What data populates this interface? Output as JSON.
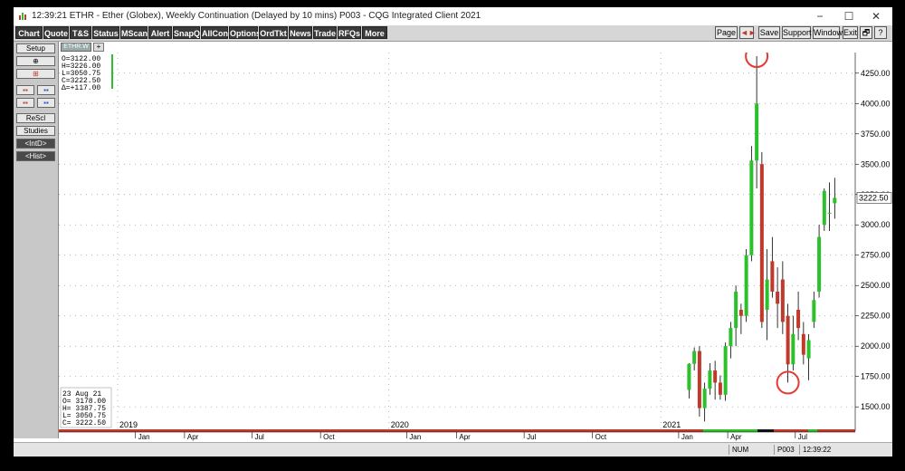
{
  "titlebar": {
    "time": "12:39:21",
    "title": "ETHR - Ether (Globex), Weekly Continuation (Delayed by 10 mins)   P003 - CQG Integrated Client 2021",
    "minimize": "−",
    "maximize": "☐",
    "close": "✕"
  },
  "toolbar": {
    "left": [
      "Chart",
      "Quote",
      "T&S",
      "Status",
      "MScan",
      "Alert",
      "SnapQ",
      "AllCon",
      "Options",
      "OrdTkt",
      "News",
      "Trade",
      "RFQs",
      "More"
    ],
    "page": "Page",
    "arrows": "◄►",
    "save": "Save",
    "support": "Support",
    "window": "Window",
    "exit": "Exit",
    "restore": "🗗",
    "help": "?"
  },
  "sidebar": {
    "setup": "Setup",
    "zoom": "⊕",
    "crosshair": "⊞",
    "b1": "▪▪",
    "b2": "▪▪",
    "b3": "▪▪",
    "b4": "▪▪",
    "rescl": "ReScl",
    "studies": "Studies",
    "intd": "<IntD>",
    "hist": "<Hist>"
  },
  "tab": {
    "name": "ETHR.W",
    "add": "+"
  },
  "status": {
    "num": "NUM",
    "page": "P003",
    "time": "12:39:22"
  },
  "chart_data": {
    "type": "ohlc",
    "symbol": "ETHR",
    "ylim": [
      1300,
      4420
    ],
    "yticks": [
      1500,
      1750,
      2000,
      2250,
      2500,
      2750,
      3000,
      3250,
      3500,
      3750,
      4000,
      4250
    ],
    "ytick_labels": [
      "1500.00",
      "1750.00",
      "2000.00",
      "2250.00",
      "2500.00",
      "2750.00",
      "3000.00",
      "3250.00",
      "3500.00",
      "3750.00",
      "4000.00",
      "4250.00"
    ],
    "last_price_label": "3222.50",
    "last_price": 3222.5,
    "xticks": [
      {
        "label": "2019",
        "year": true
      },
      {
        "label": "Jan"
      },
      {
        "label": "Apr"
      },
      {
        "label": "Jul"
      },
      {
        "label": "Oct"
      },
      {
        "label": "2020",
        "year": true
      },
      {
        "label": "Jan"
      },
      {
        "label": "Apr"
      },
      {
        "label": "Jul"
      },
      {
        "label": "Oct"
      },
      {
        "label": "2021",
        "year": true
      },
      {
        "label": "Jan"
      },
      {
        "label": "Apr"
      },
      {
        "label": "Jul"
      }
    ],
    "header_info": [
      "O=3122.00",
      "H=3226.00",
      "L=3050.75",
      "C=3222.50",
      "Δ=+117.00"
    ],
    "cursor_info": [
      "23 Aug 21",
      "O= 3178.00",
      "H= 3387.75",
      "L= 3050.75",
      "C= 3222.50"
    ],
    "bars": [
      {
        "date": "2021-02-08",
        "o": 1640,
        "h": 1860,
        "l": 1570,
        "c": 1855
      },
      {
        "date": "2021-02-15",
        "o": 1855,
        "h": 1990,
        "l": 1800,
        "c": 1960
      },
      {
        "date": "2021-02-22",
        "o": 1960,
        "h": 2000,
        "l": 1420,
        "c": 1490
      },
      {
        "date": "2021-03-01",
        "o": 1490,
        "h": 1700,
        "l": 1380,
        "c": 1650
      },
      {
        "date": "2021-03-08",
        "o": 1650,
        "h": 1860,
        "l": 1600,
        "c": 1800
      },
      {
        "date": "2021-03-15",
        "o": 1800,
        "h": 1880,
        "l": 1560,
        "c": 1700
      },
      {
        "date": "2021-03-22",
        "o": 1700,
        "h": 1760,
        "l": 1560,
        "c": 1600
      },
      {
        "date": "2021-03-29",
        "o": 1600,
        "h": 2030,
        "l": 1550,
        "c": 2000
      },
      {
        "date": "2021-04-05",
        "o": 2000,
        "h": 2200,
        "l": 1900,
        "c": 2150
      },
      {
        "date": "2021-04-12",
        "o": 2150,
        "h": 2500,
        "l": 2000,
        "c": 2450
      },
      {
        "date": "2021-04-19",
        "o": 2300,
        "h": 2350,
        "l": 2100,
        "c": 2250
      },
      {
        "date": "2021-04-26",
        "o": 2250,
        "h": 2800,
        "l": 2200,
        "c": 2750
      },
      {
        "date": "2021-05-03",
        "o": 2750,
        "h": 3650,
        "l": 2700,
        "c": 3530
      },
      {
        "date": "2021-05-10",
        "o": 3530,
        "h": 4390,
        "l": 3300,
        "c": 4000
      },
      {
        "date": "2021-05-17",
        "o": 3500,
        "h": 3600,
        "l": 2150,
        "c": 2200
      },
      {
        "date": "2021-05-24",
        "o": 2300,
        "h": 2800,
        "l": 2050,
        "c": 2550
      },
      {
        "date": "2021-05-31",
        "o": 2700,
        "h": 2900,
        "l": 2400,
        "c": 2450
      },
      {
        "date": "2021-06-07",
        "o": 2450,
        "h": 2650,
        "l": 2150,
        "c": 2350
      },
      {
        "date": "2021-06-14",
        "o": 2550,
        "h": 2700,
        "l": 2100,
        "c": 2200
      },
      {
        "date": "2021-06-21",
        "o": 2250,
        "h": 2350,
        "l": 1700,
        "c": 1850
      },
      {
        "date": "2021-06-28",
        "o": 1850,
        "h": 2250,
        "l": 1800,
        "c": 2100
      },
      {
        "date": "2021-07-05",
        "o": 2300,
        "h": 2450,
        "l": 2050,
        "c": 2150
      },
      {
        "date": "2021-07-12",
        "o": 2100,
        "h": 2200,
        "l": 1850,
        "c": 1930
      },
      {
        "date": "2021-07-19",
        "o": 1900,
        "h": 2100,
        "l": 1720,
        "c": 2050
      },
      {
        "date": "2021-07-26",
        "o": 2200,
        "h": 2450,
        "l": 2150,
        "c": 2380
      },
      {
        "date": "2021-08-02",
        "o": 2450,
        "h": 3000,
        "l": 2400,
        "c": 2900
      },
      {
        "date": "2021-08-09",
        "o": 3000,
        "h": 3300,
        "l": 2950,
        "c": 3280
      },
      {
        "date": "2021-08-16",
        "o": 3100,
        "h": 3350,
        "l": 2950,
        "c": 3100
      },
      {
        "date": "2021-08-23",
        "o": 3178,
        "h": 3387.75,
        "l": 3050.75,
        "c": 3222.5
      }
    ],
    "annotations": [
      {
        "type": "circle",
        "date": "2021-05-10",
        "value": 4390,
        "color": "#e53935"
      },
      {
        "type": "circle",
        "date": "2021-06-21",
        "value": 1700,
        "color": "#e53935"
      }
    ],
    "colors": {
      "up": "#2bc12b",
      "down": "#c0392b",
      "wick": "#000000",
      "axis_bar": "#c0392b",
      "grid": "#9a9a9a"
    }
  }
}
